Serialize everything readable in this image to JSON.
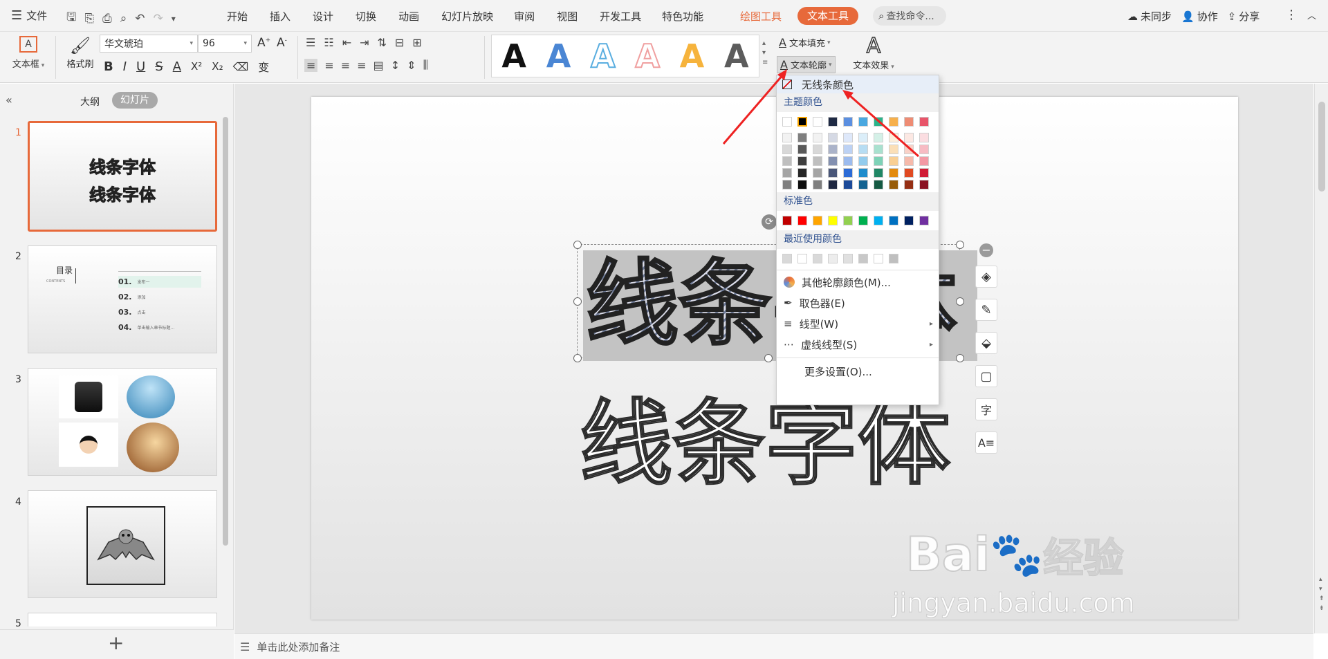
{
  "topbar": {
    "file_label": "文件",
    "tabs": [
      "开始",
      "插入",
      "设计",
      "切换",
      "动画",
      "幻灯片放映",
      "审阅",
      "视图",
      "开发工具",
      "特色功能"
    ],
    "drawing_tools": "绘图工具",
    "text_tools": "文本工具",
    "search_placeholder": "查找命令...",
    "sync": "未同步",
    "collab": "协作",
    "share": "分享"
  },
  "ribbon": {
    "textbox": "文本框",
    "format_painter": "格式刷",
    "font_name": "华文琥珀",
    "font_size": "96",
    "bold": "B",
    "italic": "I",
    "underline": "U",
    "strike": "S",
    "font_color": "A",
    "superscript": "X²",
    "subscript": "X₂",
    "text_fill": "文本填充",
    "text_outline": "文本轮廓",
    "text_effect": "文本效果",
    "style_letters": [
      "A",
      "A",
      "A",
      "A",
      "A",
      "A"
    ],
    "style_colors": [
      "#111111",
      "#4a86d4",
      "#5aaee0",
      "#f0a0a0",
      "#f6b33c",
      "#5c5c5c"
    ]
  },
  "left_panel": {
    "tab_outline": "大纲",
    "tab_slides": "幻灯片",
    "slide_numbers": [
      "1",
      "2",
      "3",
      "4",
      "5"
    ],
    "slide1_line1": "线条字体",
    "slide1_line2": "线条字体",
    "slide2_title": "目录",
    "slide2_sub": "CONTENTS",
    "slide2_items": [
      {
        "num": "01.",
        "text": "发布一"
      },
      {
        "num": "02.",
        "text": "添加"
      },
      {
        "num": "03.",
        "text": "点击"
      },
      {
        "num": "04.",
        "text": "单击输入章节标题..."
      }
    ],
    "add_label": "+"
  },
  "slide": {
    "top_text": "线条字体",
    "bottom_text": "线条字体"
  },
  "menu": {
    "no_line": "无线条颜色",
    "theme_colors": "主题颜色",
    "standard_colors": "标准色",
    "recent_colors": "最近使用颜色",
    "more_outline": "其他轮廓颜色(M)...",
    "eyedropper": "取色器(E)",
    "line_type": "线型(W)",
    "dash_type": "虚线线型(S)",
    "more_settings": "更多设置(O)...",
    "theme_top": [
      "#ffffff",
      "#000000",
      "#ffffff",
      "#1f2a44",
      "#5b8fe0",
      "#4aa8e0",
      "#2bb48a",
      "#f6b04c",
      "#ee8c74",
      "#e8556a"
    ],
    "theme_cols": [
      [
        "#f2f2f2",
        "#d8d8d8",
        "#bfbfbf",
        "#a5a5a5",
        "#7f7f7f"
      ],
      [
        "#7f7f7f",
        "#595959",
        "#3f3f3f",
        "#262626",
        "#0d0d0d"
      ],
      [
        "#f2f2f2",
        "#d8d8d8",
        "#bfbfbf",
        "#a5a5a5",
        "#7f7f7f"
      ],
      [
        "#d5d9e4",
        "#abb3c9",
        "#8390b0",
        "#4a5779",
        "#1e2740"
      ],
      [
        "#dee8fa",
        "#bdd2f4",
        "#9cbbee",
        "#2c6bd6",
        "#1c4a99"
      ],
      [
        "#dbeef9",
        "#b7ddf3",
        "#93cced",
        "#1f8ccc",
        "#146391"
      ],
      [
        "#d4f0e7",
        "#a9e1cf",
        "#7ed2b7",
        "#208765",
        "#155a43"
      ],
      [
        "#fdefdb",
        "#fbdfb7",
        "#f9cf93",
        "#e38a0e",
        "#975c09"
      ],
      [
        "#fce8e3",
        "#f9d1c7",
        "#f6baab",
        "#e04a22",
        "#952f14"
      ],
      [
        "#fbdde1",
        "#f7bbc3",
        "#f399a5",
        "#d01c35",
        "#8a1223"
      ]
    ],
    "standard": [
      "#c00000",
      "#ff0000",
      "#ffa500",
      "#ffff00",
      "#92d050",
      "#00b050",
      "#00b0f0",
      "#0070c0",
      "#002060",
      "#7030a0"
    ],
    "recent": [
      "#d9d9d9",
      "#ffffff",
      "#d9d9d9",
      "#ededed",
      "#e0e0e0",
      "#c8c8c8",
      "#ffffff",
      "#bfbfbf"
    ]
  },
  "notes": "单击此处添加备注",
  "watermark": {
    "brand": "Bai",
    "logo_text": "经验",
    "url": "jingyan.baidu.com"
  }
}
